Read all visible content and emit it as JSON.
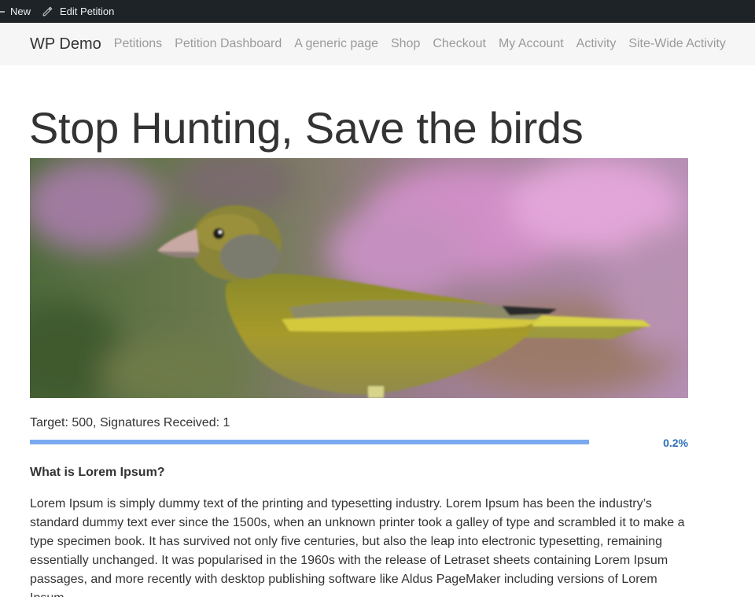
{
  "admin_bar": {
    "new_label": "New",
    "edit_label": "Edit Petition"
  },
  "nav": {
    "brand": "WP Demo",
    "links": [
      "Petitions",
      "Petition Dashboard",
      "A generic page",
      "Shop",
      "Checkout",
      "My Account",
      "Activity",
      "Site-Wide Activity"
    ]
  },
  "petition": {
    "title": "Stop Hunting, Save the birds",
    "image_alt": "Greenfinch perched against a blurred pink and green background",
    "target_text": "Target: 500, Signatures Received: 1",
    "progress_percent": 0.2,
    "progress_label": "0.2%",
    "section_heading": "What is Lorem Ipsum?",
    "body": "Lorem Ipsum is simply dummy text of the printing and typesetting industry. Lorem Ipsum has been the industry’s standard dummy text ever since the 1500s, when an unknown printer took a galley of type and scrambled it to make a type specimen book. It has survived not only five centuries, but also the leap into electronic typesetting, remaining essentially unchanged. It was popularised in the 1960s with the release of Letraset sheets containing Lorem Ipsum passages, and more recently with desktop publishing software like Aldus PageMaker including versions of Lorem Ipsum."
  },
  "colors": {
    "admin_bar_bg": "#1d2327",
    "nav_bg": "#f6f6f6",
    "progress_fill": "#7aa9f0",
    "progress_label": "#2e6db8"
  },
  "icons": {
    "admin_new": "plus-icon",
    "admin_edit": "pencil-icon"
  }
}
